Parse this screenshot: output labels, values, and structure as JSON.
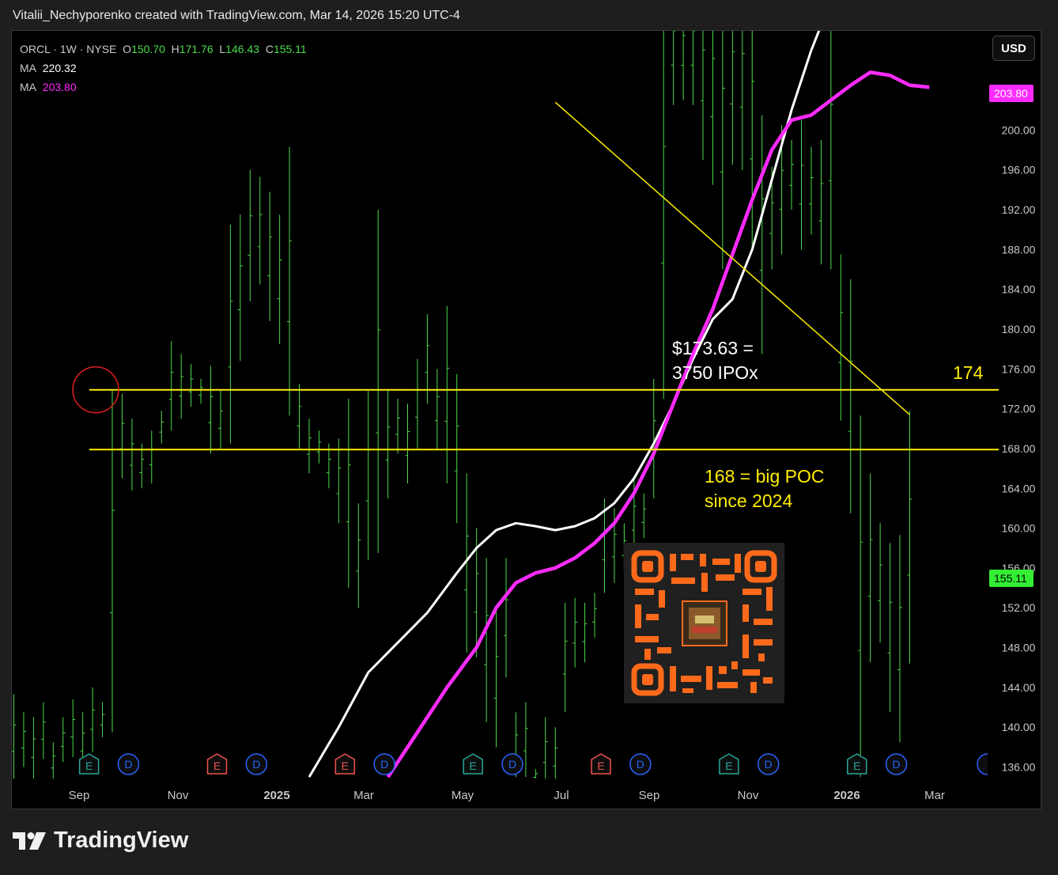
{
  "credit": "Vitalii_Nechyporenko created with TradingView.com, Mar 14, 2026 15:20 UTC-4",
  "legend": {
    "symbol": "ORCL · 1W · NYSE",
    "o_label": "O",
    "o": "150.70",
    "h_label": "H",
    "h": "171.76",
    "l_label": "L",
    "l": "146.43",
    "c_label": "C",
    "c": "155.11",
    "ma1_label": "MA",
    "ma1": "220.32",
    "ma2_label": "MA",
    "ma2": "203.80"
  },
  "currency": "USD",
  "tags": {
    "ma": "203.80",
    "last": "155.11"
  },
  "notes": {
    "white_line1": "$173.63 =",
    "white_line2": "3750 IPOx",
    "yellow_line1": "168 = big POC",
    "yellow_line2": "since 2024",
    "level_174": "174"
  },
  "brand": "TradingView",
  "colors": {
    "up": "#4cdb4c",
    "ma_fast": "#ffffff",
    "ma_slow": "#ff2bff",
    "levels": "#ffee00",
    "circle": "#e01f1f",
    "earnings": "#26a69a",
    "earnings_red": "#ef5350",
    "dividend": "#2962ff"
  },
  "chart_data": {
    "type": "ohlc",
    "symbol": "ORCL",
    "interval": "1W",
    "exchange": "NYSE",
    "ylim": [
      134,
      214
    ],
    "y_ticks": [
      136,
      140,
      144,
      148,
      152,
      156,
      160,
      164,
      168,
      172,
      176,
      180,
      184,
      188,
      192,
      196,
      200
    ],
    "x_ticks": [
      "Sep",
      "Nov",
      "2025",
      "Mar",
      "May",
      "Jul",
      "Sep",
      "Nov",
      "2026",
      "Mar"
    ],
    "x_ticks_bold": [
      "2025",
      "2026"
    ],
    "horizontal_levels": [
      173.9,
      167.9
    ],
    "trendline": {
      "start": {
        "week": 55,
        "price": 202.8
      },
      "end": {
        "week": 91,
        "price": 171.4
      }
    },
    "bars": [
      {
        "h": 143.3,
        "l": 134.5
      },
      {
        "h": 141.5,
        "l": 136.0
      },
      {
        "h": 141.0,
        "l": 134.8
      },
      {
        "h": 142.5,
        "l": 136.8
      },
      {
        "h": 138.5,
        "l": 134.5
      },
      {
        "h": 141.0,
        "l": 136.5
      },
      {
        "h": 142.8,
        "l": 137.0
      },
      {
        "h": 141.5,
        "l": 135.5
      },
      {
        "h": 144.0,
        "l": 137.5
      },
      {
        "h": 142.5,
        "l": 139.0
      },
      {
        "h": 173.8,
        "l": 139.5
      },
      {
        "h": 173.5,
        "l": 165.0
      },
      {
        "h": 171.0,
        "l": 163.8
      },
      {
        "h": 168.5,
        "l": 164.0
      },
      {
        "h": 169.8,
        "l": 164.5
      },
      {
        "h": 171.8,
        "l": 168.5
      },
      {
        "h": 178.8,
        "l": 169.8
      },
      {
        "h": 177.5,
        "l": 171.0
      },
      {
        "h": 176.5,
        "l": 172.2
      },
      {
        "h": 175.0,
        "l": 172.5
      },
      {
        "h": 176.3,
        "l": 167.5
      },
      {
        "h": 173.8,
        "l": 168.0
      },
      {
        "h": 190.5,
        "l": 168.5
      },
      {
        "h": 191.5,
        "l": 176.8
      },
      {
        "h": 196.0,
        "l": 182.8
      },
      {
        "h": 195.3,
        "l": 184.5
      },
      {
        "h": 193.8,
        "l": 180.8
      },
      {
        "h": 191.5,
        "l": 178.5
      },
      {
        "h": 198.3,
        "l": 171.3
      },
      {
        "h": 174.5,
        "l": 168.0
      },
      {
        "h": 171.0,
        "l": 165.5
      },
      {
        "h": 169.8,
        "l": 166.5
      },
      {
        "h": 168.5,
        "l": 164.0
      },
      {
        "h": 169.0,
        "l": 160.5
      },
      {
        "h": 173.0,
        "l": 154.0
      },
      {
        "h": 162.5,
        "l": 152.0
      },
      {
        "h": 173.8,
        "l": 156.8
      },
      {
        "h": 192.0,
        "l": 157.5
      },
      {
        "h": 174.0,
        "l": 163.0
      },
      {
        "h": 173.0,
        "l": 167.5
      },
      {
        "h": 172.5,
        "l": 164.5
      },
      {
        "h": 177.0,
        "l": 168.0
      },
      {
        "h": 181.5,
        "l": 172.5
      },
      {
        "h": 176.0,
        "l": 168.0
      },
      {
        "h": 182.3,
        "l": 164.5
      },
      {
        "h": 175.5,
        "l": 160.5
      },
      {
        "h": 165.5,
        "l": 147.5
      },
      {
        "h": 160.0,
        "l": 147.0
      },
      {
        "h": 157.0,
        "l": 140.5
      },
      {
        "h": 152.0,
        "l": 138.0
      },
      {
        "h": 157.0,
        "l": 145.0
      },
      {
        "h": 141.5,
        "l": 135.0
      },
      {
        "h": 142.5,
        "l": 135.0
      },
      {
        "h": 135.8,
        "l": 134.5
      },
      {
        "h": 141.0,
        "l": 134.0
      },
      {
        "h": 140.0,
        "l": 134.0
      },
      {
        "h": 152.5,
        "l": 141.5
      },
      {
        "h": 153.0,
        "l": 146.0
      },
      {
        "h": 152.5,
        "l": 146.5
      },
      {
        "h": 153.5,
        "l": 149.0
      },
      {
        "h": 163.0,
        "l": 153.5
      },
      {
        "h": 162.0,
        "l": 154.5
      },
      {
        "h": 160.5,
        "l": 155.5
      },
      {
        "h": 165.0,
        "l": 157.0
      },
      {
        "h": 163.5,
        "l": 159.0
      },
      {
        "h": 175.0,
        "l": 163.0
      },
      {
        "h": 212.0,
        "l": 173.0
      },
      {
        "h": 214.0,
        "l": 202.5
      },
      {
        "h": 213.0,
        "l": 203.0
      },
      {
        "h": 214.0,
        "l": 202.5
      },
      {
        "h": 214.0,
        "l": 197.0
      },
      {
        "h": 214.0,
        "l": 194.5
      },
      {
        "h": 214.0,
        "l": 186.0
      },
      {
        "h": 214.0,
        "l": 196.5
      },
      {
        "h": 214.0,
        "l": 196.0
      },
      {
        "h": 214.0,
        "l": 188.0
      },
      {
        "h": 201.5,
        "l": 177.5
      },
      {
        "h": 196.3,
        "l": 186.0
      },
      {
        "h": 200.5,
        "l": 187.5
      },
      {
        "h": 199.0,
        "l": 192.0
      },
      {
        "h": 201.0,
        "l": 188.0
      },
      {
        "h": 198.3,
        "l": 189.5
      },
      {
        "h": 199.0,
        "l": 186.5
      },
      {
        "h": 211.5,
        "l": 186.0
      },
      {
        "h": 187.5,
        "l": 170.8
      },
      {
        "h": 185.0,
        "l": 161.5
      },
      {
        "h": 171.3,
        "l": 135.0
      },
      {
        "h": 165.5,
        "l": 146.5
      },
      {
        "h": 160.5,
        "l": 148.5
      },
      {
        "h": 158.5,
        "l": 141.5
      },
      {
        "h": 159.3,
        "l": 138.5
      },
      {
        "h": 171.8,
        "l": 146.4
      }
    ],
    "ma_fast": {
      "name": "MA",
      "value": "220.32",
      "points": [
        [
          30,
          135.0
        ],
        [
          33,
          140.0
        ],
        [
          36,
          145.5
        ],
        [
          39,
          148.5
        ],
        [
          42,
          151.5
        ],
        [
          45,
          155.5
        ],
        [
          47,
          158.0
        ],
        [
          49,
          159.8
        ],
        [
          51,
          160.5
        ],
        [
          53,
          160.2
        ],
        [
          55,
          159.8
        ],
        [
          57,
          160.2
        ],
        [
          59,
          161.0
        ],
        [
          61,
          162.5
        ],
        [
          63,
          165.0
        ],
        [
          65,
          168.5
        ],
        [
          67,
          172.5
        ],
        [
          69,
          177.0
        ],
        [
          71,
          181.0
        ],
        [
          73,
          183.0
        ],
        [
          75,
          188.0
        ],
        [
          77,
          195.0
        ],
        [
          79,
          202.0
        ],
        [
          81,
          208.0
        ],
        [
          83,
          213.0
        ],
        [
          84,
          214.0
        ]
      ]
    },
    "ma_slow": {
      "name": "MA",
      "value": "203.80",
      "points": [
        [
          38,
          135.0
        ],
        [
          41,
          139.5
        ],
        [
          44,
          144.0
        ],
        [
          47,
          148.0
        ],
        [
          49,
          152.0
        ],
        [
          51,
          154.5
        ],
        [
          53,
          155.5
        ],
        [
          55,
          156.0
        ],
        [
          57,
          157.0
        ],
        [
          59,
          158.5
        ],
        [
          61,
          160.5
        ],
        [
          63,
          163.5
        ],
        [
          65,
          167.5
        ],
        [
          67,
          172.5
        ],
        [
          69,
          177.5
        ],
        [
          71,
          182.0
        ],
        [
          73,
          187.5
        ],
        [
          75,
          193.0
        ],
        [
          77,
          198.0
        ],
        [
          79,
          201.0
        ],
        [
          81,
          201.5
        ],
        [
          83,
          203.0
        ],
        [
          85,
          204.5
        ],
        [
          87,
          205.8
        ],
        [
          89,
          205.5
        ],
        [
          91,
          204.5
        ],
        [
          93,
          204.3
        ]
      ]
    },
    "events": [
      {
        "type": "E",
        "week": 7,
        "color": "green"
      },
      {
        "type": "D",
        "week": 11,
        "color": "blue"
      },
      {
        "type": "E",
        "week": 20,
        "color": "red"
      },
      {
        "type": "D",
        "week": 24,
        "color": "blue"
      },
      {
        "type": "E",
        "week": 33,
        "color": "red"
      },
      {
        "type": "D",
        "week": 37,
        "color": "blue"
      },
      {
        "type": "E",
        "week": 46,
        "color": "green"
      },
      {
        "type": "D",
        "week": 50,
        "color": "blue"
      },
      {
        "type": "E",
        "week": 59,
        "color": "red"
      },
      {
        "type": "D",
        "week": 63,
        "color": "blue"
      },
      {
        "type": "E",
        "week": 72,
        "color": "green"
      },
      {
        "type": "D",
        "week": 76,
        "color": "blue"
      },
      {
        "type": "E",
        "week": 85,
        "color": "green"
      },
      {
        "type": "D",
        "week": 89,
        "color": "blue"
      }
    ],
    "legend_placement": "top-left",
    "grid": false
  }
}
